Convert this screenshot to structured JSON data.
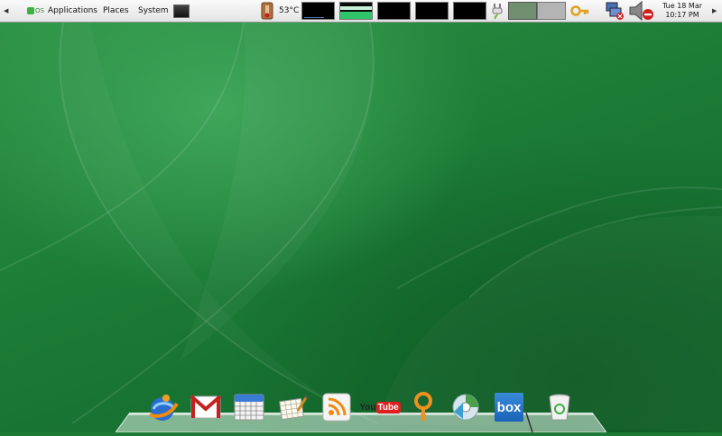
{
  "panel": {
    "os_logo": "OS",
    "menu": {
      "applications": "Applications",
      "places": "Places",
      "system": "System"
    },
    "temperature": "53°C",
    "clock": {
      "date": "Tue 18 Mar",
      "time": "10:17 PM"
    }
  },
  "dock": {
    "items": [
      {
        "name": "web-browser-icon"
      },
      {
        "name": "gmail-icon"
      },
      {
        "name": "calendar-icon"
      },
      {
        "name": "spreadsheet-icon"
      },
      {
        "name": "rss-feed-icon"
      },
      {
        "name": "youtube-icon",
        "label_you": "You",
        "label_tube": "Tube"
      },
      {
        "name": "search-icon"
      },
      {
        "name": "media-player-icon"
      },
      {
        "name": "box-icon",
        "label": "box"
      },
      {
        "name": "trash-icon"
      }
    ]
  },
  "colors": {
    "desktop_green": "#1d7a35",
    "panel_bg": "#f0f0f0",
    "gmail_red": "#c5221f",
    "youtube_red": "#e02020",
    "box_blue": "#1a73c8"
  }
}
